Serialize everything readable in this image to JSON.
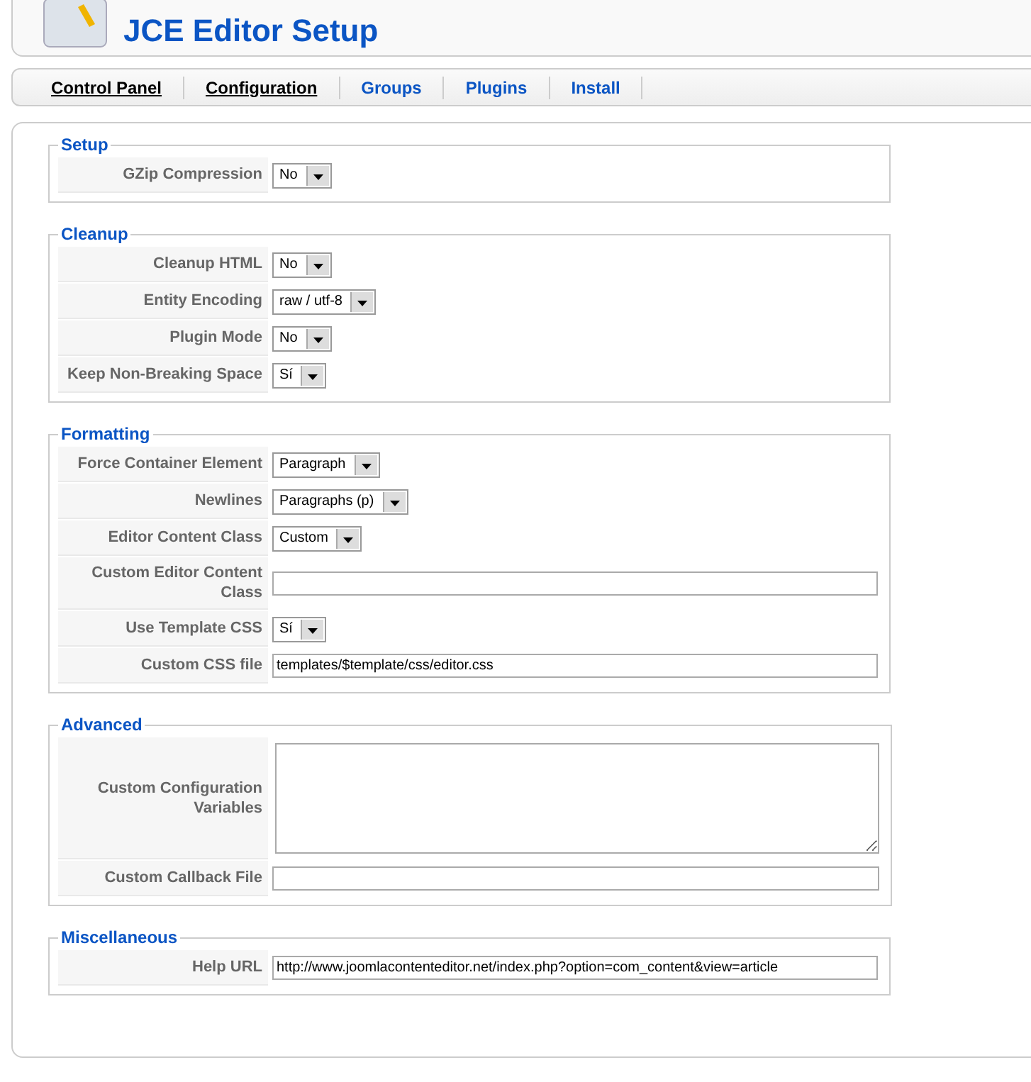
{
  "header": {
    "title": "JCE Editor Setup"
  },
  "tabs": [
    {
      "label": "Control Panel",
      "visited": true
    },
    {
      "label": "Configuration",
      "visited": true
    },
    {
      "label": "Groups",
      "visited": false
    },
    {
      "label": "Plugins",
      "visited": false
    },
    {
      "label": "Install",
      "visited": false
    }
  ],
  "sections": [
    {
      "legend": "Setup",
      "fields": [
        {
          "kind": "select",
          "label": "GZip Compression",
          "value": "No"
        }
      ]
    },
    {
      "legend": "Cleanup",
      "fields": [
        {
          "kind": "select",
          "label": "Cleanup HTML",
          "value": "No"
        },
        {
          "kind": "select",
          "label": "Entity Encoding",
          "value": "raw / utf-8"
        },
        {
          "kind": "select",
          "label": "Plugin Mode",
          "value": "No"
        },
        {
          "kind": "select",
          "label": "Keep Non-Breaking Space",
          "value": "Sí"
        }
      ]
    },
    {
      "legend": "Formatting",
      "fields": [
        {
          "kind": "select",
          "label": "Force Container Element",
          "value": "Paragraph"
        },
        {
          "kind": "select",
          "label": "Newlines",
          "value": "Paragraphs (p)"
        },
        {
          "kind": "select",
          "label": "Editor Content Class",
          "value": "Custom"
        },
        {
          "kind": "text",
          "label": "Custom Editor Content Class"
        },
        {
          "kind": "select",
          "label": "Use Template CSS",
          "value": "Sí"
        },
        {
          "kind": "text",
          "label": "Custom CSS file",
          "value": "templates/$template/css/editor.css"
        }
      ]
    },
    {
      "legend": "Advanced",
      "fields": [
        {
          "kind": "textarea",
          "label": "Custom Configuration Variables"
        },
        {
          "kind": "text",
          "label": "Custom Callback File"
        }
      ]
    },
    {
      "legend": "Miscellaneous",
      "fields": [
        {
          "kind": "text",
          "label": "Help URL",
          "value": "http://www.joomlacontenteditor.net/index.php?option=com_content&view=article"
        }
      ]
    }
  ]
}
